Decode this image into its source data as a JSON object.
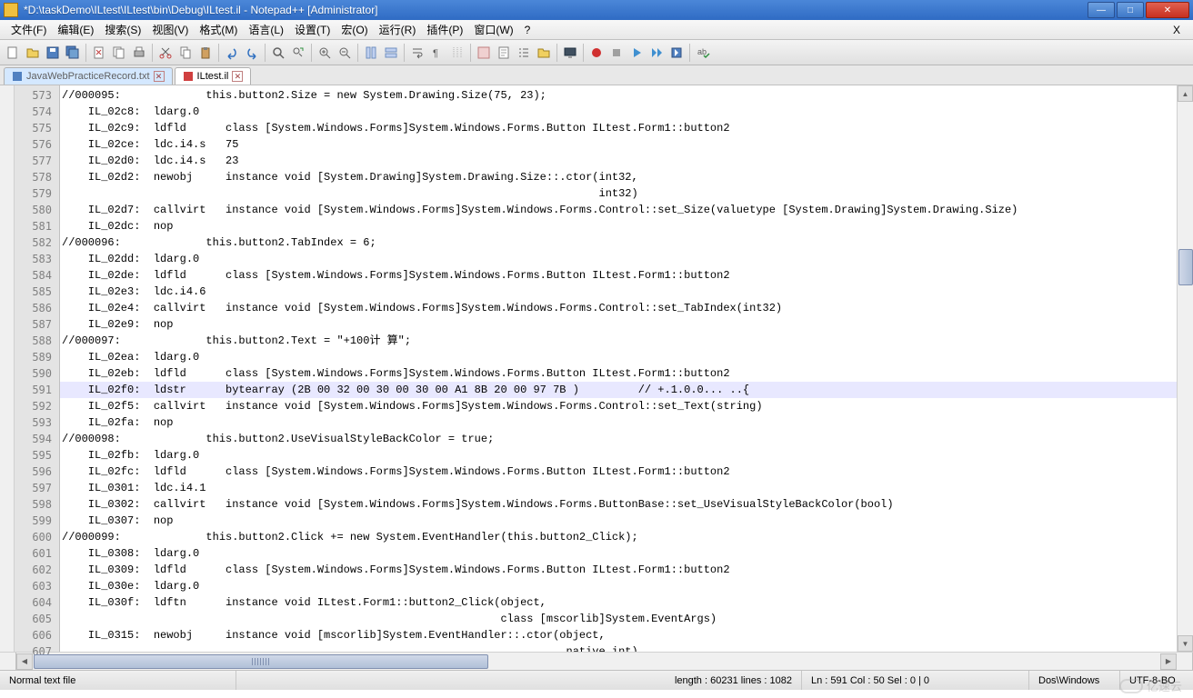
{
  "window": {
    "title": "*D:\\taskDemo\\ILtest\\ILtest\\bin\\Debug\\ILtest.il - Notepad++ [Administrator]"
  },
  "menu": {
    "items": [
      "文件(F)",
      "编辑(E)",
      "搜索(S)",
      "视图(V)",
      "格式(M)",
      "语言(L)",
      "设置(T)",
      "宏(O)",
      "运行(R)",
      "插件(P)",
      "窗口(W)",
      "?"
    ]
  },
  "tabs": {
    "t0": "JavaWebPracticeRecord.txt",
    "t1": "ILtest.il"
  },
  "gutter_start": 573,
  "lines": [
    "//000095:             this.button2.Size = new System.Drawing.Size(75, 23);",
    "    IL_02c8:  ldarg.0",
    "    IL_02c9:  ldfld      class [System.Windows.Forms]System.Windows.Forms.Button ILtest.Form1::button2",
    "    IL_02ce:  ldc.i4.s   75",
    "    IL_02d0:  ldc.i4.s   23",
    "    IL_02d2:  newobj     instance void [System.Drawing]System.Drawing.Size::.ctor(int32,",
    "                                                                                  int32)",
    "    IL_02d7:  callvirt   instance void [System.Windows.Forms]System.Windows.Forms.Control::set_Size(valuetype [System.Drawing]System.Drawing.Size)",
    "    IL_02dc:  nop",
    "//000096:             this.button2.TabIndex = 6;",
    "    IL_02dd:  ldarg.0",
    "    IL_02de:  ldfld      class [System.Windows.Forms]System.Windows.Forms.Button ILtest.Form1::button2",
    "    IL_02e3:  ldc.i4.6",
    "    IL_02e4:  callvirt   instance void [System.Windows.Forms]System.Windows.Forms.Control::set_TabIndex(int32)",
    "    IL_02e9:  nop",
    "//000097:             this.button2.Text = \"+100计 算\";",
    "    IL_02ea:  ldarg.0",
    "    IL_02eb:  ldfld      class [System.Windows.Forms]System.Windows.Forms.Button ILtest.Form1::button2",
    "    IL_02f0:  ldstr      bytearray (2B 00 32 00 30 00 30 00 A1 8B 20 00 97 7B )         // +.1.0.0... ..{",
    "    IL_02f5:  callvirt   instance void [System.Windows.Forms]System.Windows.Forms.Control::set_Text(string)",
    "    IL_02fa:  nop",
    "//000098:             this.button2.UseVisualStyleBackColor = true;",
    "    IL_02fb:  ldarg.0",
    "    IL_02fc:  ldfld      class [System.Windows.Forms]System.Windows.Forms.Button ILtest.Form1::button2",
    "    IL_0301:  ldc.i4.1",
    "    IL_0302:  callvirt   instance void [System.Windows.Forms]System.Windows.Forms.ButtonBase::set_UseVisualStyleBackColor(bool)",
    "    IL_0307:  nop",
    "//000099:             this.button2.Click += new System.EventHandler(this.button2_Click);",
    "    IL_0308:  ldarg.0",
    "    IL_0309:  ldfld      class [System.Windows.Forms]System.Windows.Forms.Button ILtest.Form1::button2",
    "    IL_030e:  ldarg.0",
    "    IL_030f:  ldftn      instance void ILtest.Form1::button2_Click(object,",
    "                                                                   class [mscorlib]System.EventArgs)",
    "    IL_0315:  newobj     instance void [mscorlib]System.EventHandler::.ctor(object,",
    "                                                                             native int)"
  ],
  "highlight_line_index": 18,
  "status": {
    "mode": "Normal text file",
    "length": "length : 60231    lines : 1082",
    "pos": "Ln : 591    Col : 50    Sel : 0 | 0",
    "eol": "Dos\\Windows",
    "enc": "UTF-8-BO"
  },
  "watermark": "亿速云"
}
